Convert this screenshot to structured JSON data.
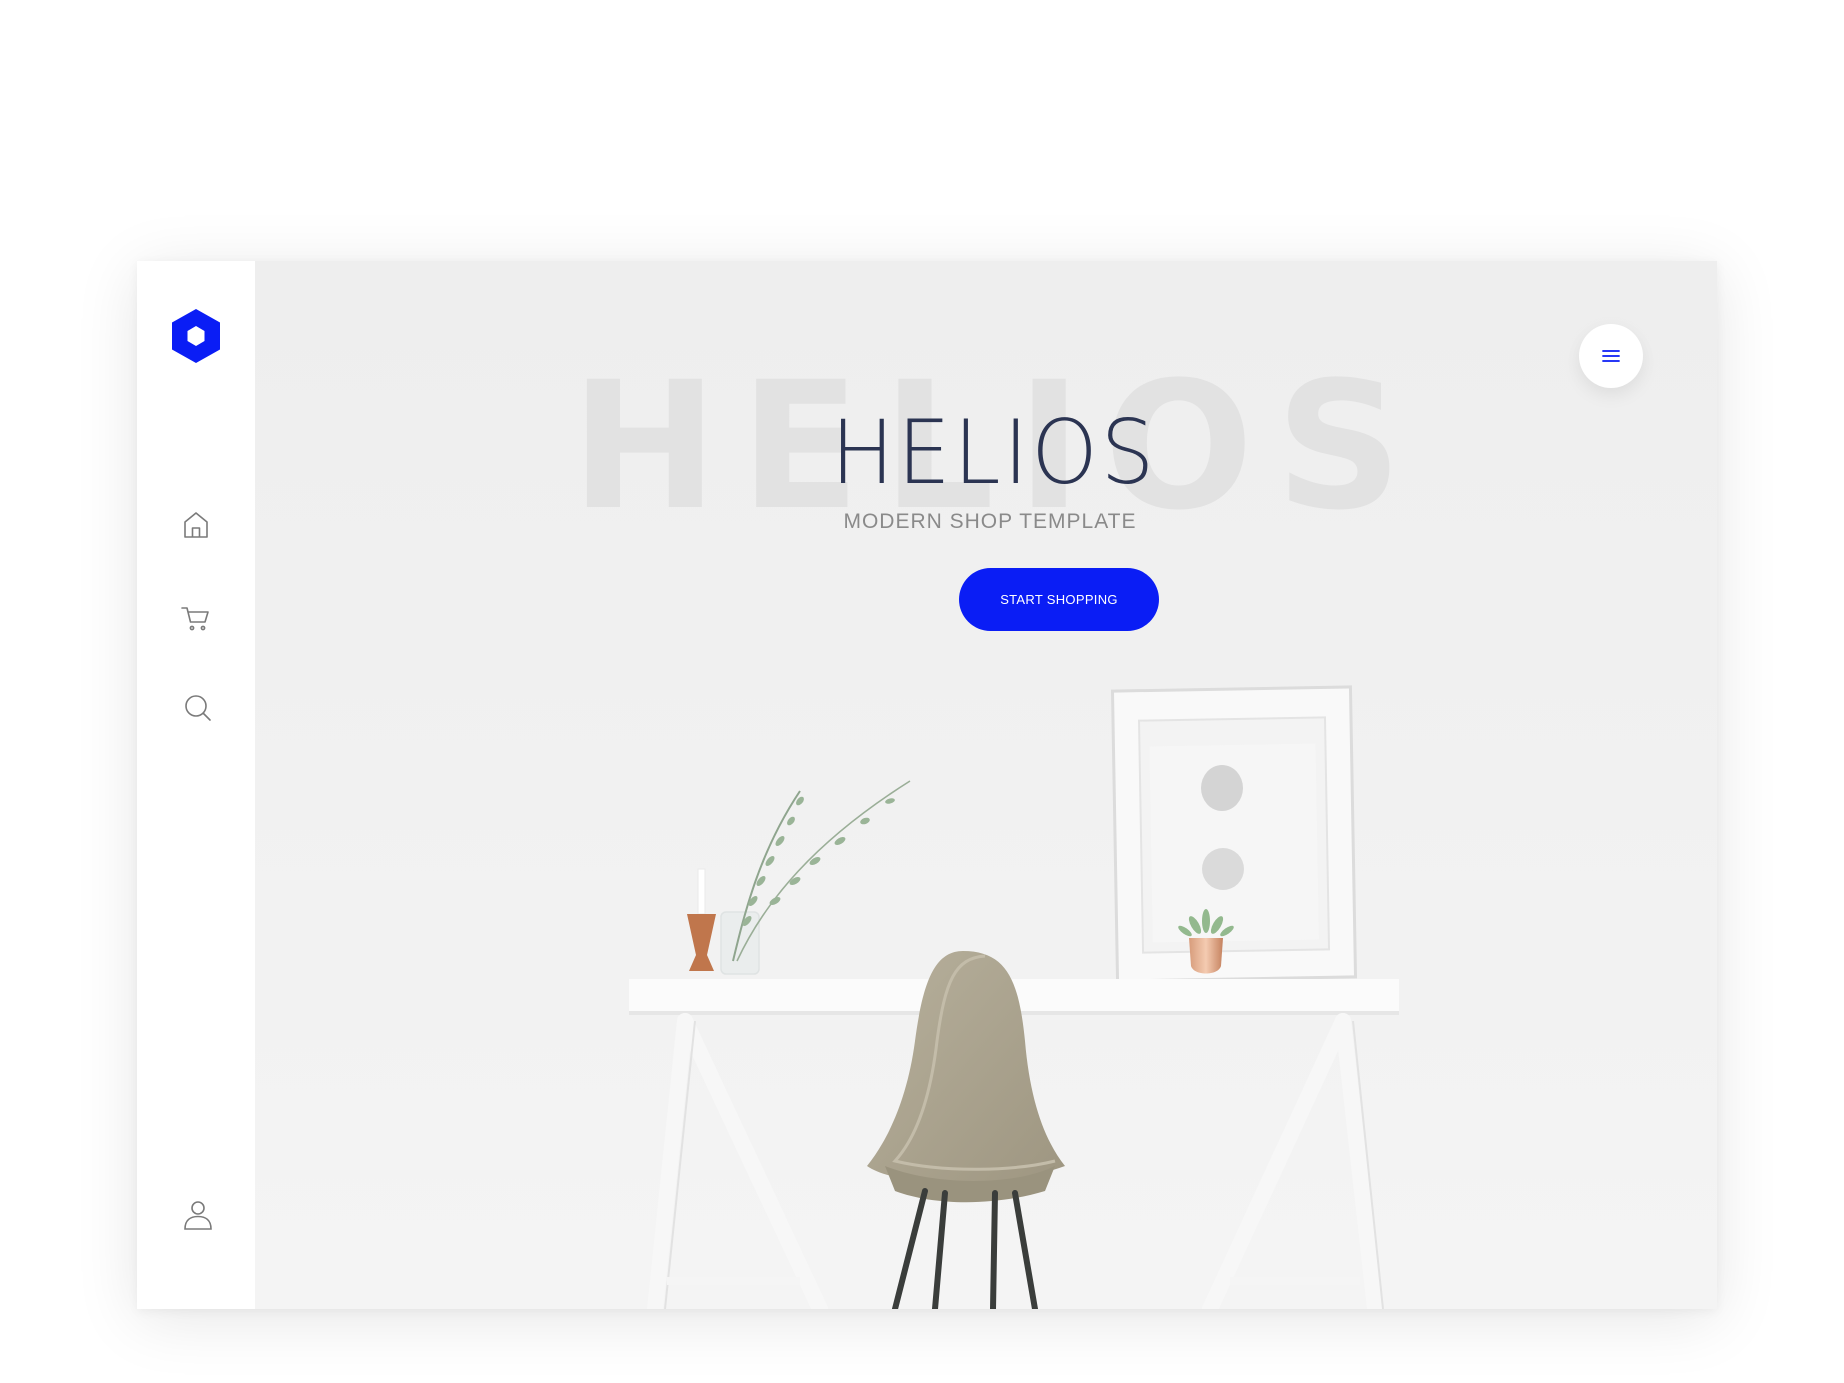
{
  "brand": {
    "logo_icon": "hexagon-logo-icon",
    "accent_color": "#0a1df5"
  },
  "sidebar": {
    "items": [
      {
        "icon": "home-icon",
        "name": "home"
      },
      {
        "icon": "cart-icon",
        "name": "cart"
      },
      {
        "icon": "search-icon",
        "name": "search"
      }
    ],
    "bottom_item": {
      "icon": "user-icon",
      "name": "account"
    }
  },
  "header": {
    "menu_icon": "hamburger-menu-icon"
  },
  "hero": {
    "watermark": "HELIOS",
    "title": "HELIOS",
    "subtitle": "MODERN SHOP TEMPLATE",
    "cta_label": "START SHOPPING"
  }
}
